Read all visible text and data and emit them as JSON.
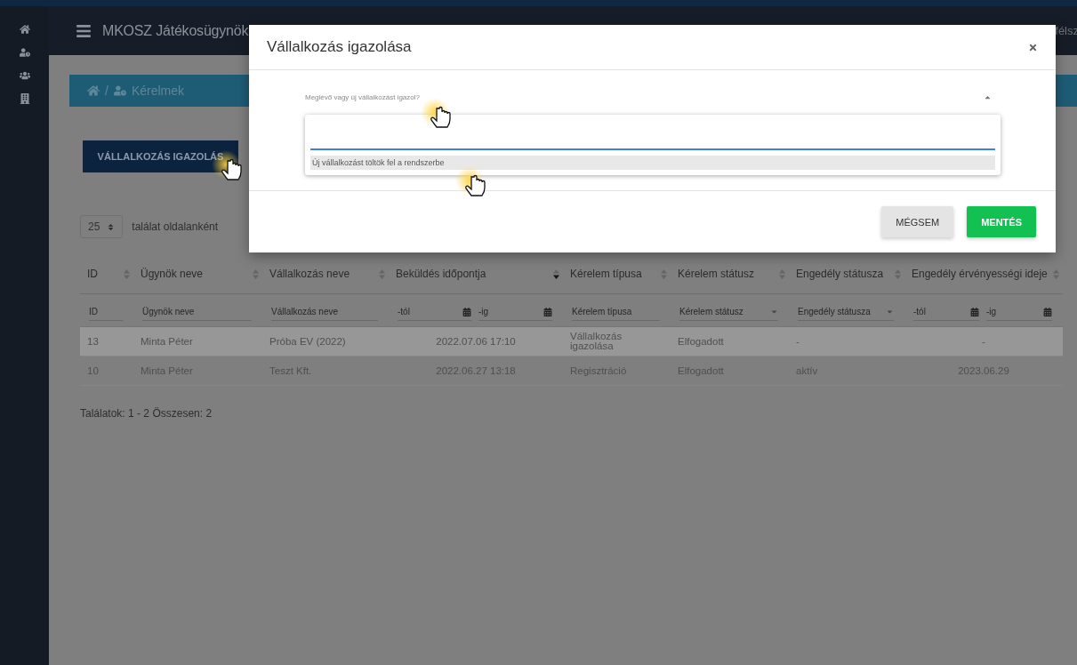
{
  "header": {
    "title": "MKOSZ Játékosügynök",
    "right_text": "félsz"
  },
  "breadcrumb": {
    "separator": "/",
    "label": "Kérelmek"
  },
  "action_button": {
    "label": "VÁLLALKOZÁS IGAZOLÁS"
  },
  "page_size": {
    "value": "25",
    "label": "találat oldalanként"
  },
  "table": {
    "columns": [
      {
        "label": "ID",
        "sorted": false
      },
      {
        "label": "Ügynök neve",
        "sorted": false
      },
      {
        "label": "Vállalkozás neve",
        "sorted": false
      },
      {
        "label": "Beküldés időpontja",
        "sorted": true
      },
      {
        "label": "Kérelem típusa",
        "sorted": false
      },
      {
        "label": "Kérelem státusz",
        "sorted": false
      },
      {
        "label": "Engedély státusza",
        "sorted": false
      },
      {
        "label": "Engedély érvényességi ideje",
        "sorted": false
      }
    ],
    "filters": [
      {
        "kind": "text",
        "placeholder": "ID"
      },
      {
        "kind": "text",
        "placeholder": "Ügynök neve"
      },
      {
        "kind": "text",
        "placeholder": "Vállalkozás neve"
      },
      {
        "kind": "date_range",
        "from": "-tól",
        "to": "-ig"
      },
      {
        "kind": "text",
        "placeholder": "Kérelem típusa"
      },
      {
        "kind": "select",
        "placeholder": "Kérelem státusz"
      },
      {
        "kind": "select",
        "placeholder": "Engedély státusza"
      },
      {
        "kind": "date_range",
        "from": "-tól",
        "to": "-ig"
      }
    ],
    "rows": [
      {
        "highlighted": true,
        "cells": [
          "13",
          "Minta Péter",
          "Próba EV (2022)",
          "2022.07.06 17:10",
          "Vállalkozás igazolása",
          "Elfogadott",
          "-",
          "-"
        ]
      },
      {
        "highlighted": false,
        "cells": [
          "10",
          "Minta Péter",
          "Teszt Kft.",
          "2022.06.27 13:18",
          "Regisztráció",
          "Elfogadott",
          "aktív",
          "2023.06.29"
        ]
      }
    ]
  },
  "summary": "Találatok: 1 - 2 Összesen: 2",
  "modal": {
    "title": "Vállalkozás igazolása",
    "field_label": "Meglévő vagy új vállalkozást igazol?",
    "expanded": true,
    "options": [
      {
        "label": "Új vállalkozást töltök fel a rendszerbe",
        "highlighted": true
      }
    ],
    "buttons": [
      {
        "label": "MÉGSEM",
        "kind": "secondary"
      },
      {
        "label": "MENTÉS",
        "kind": "primary"
      }
    ]
  }
}
